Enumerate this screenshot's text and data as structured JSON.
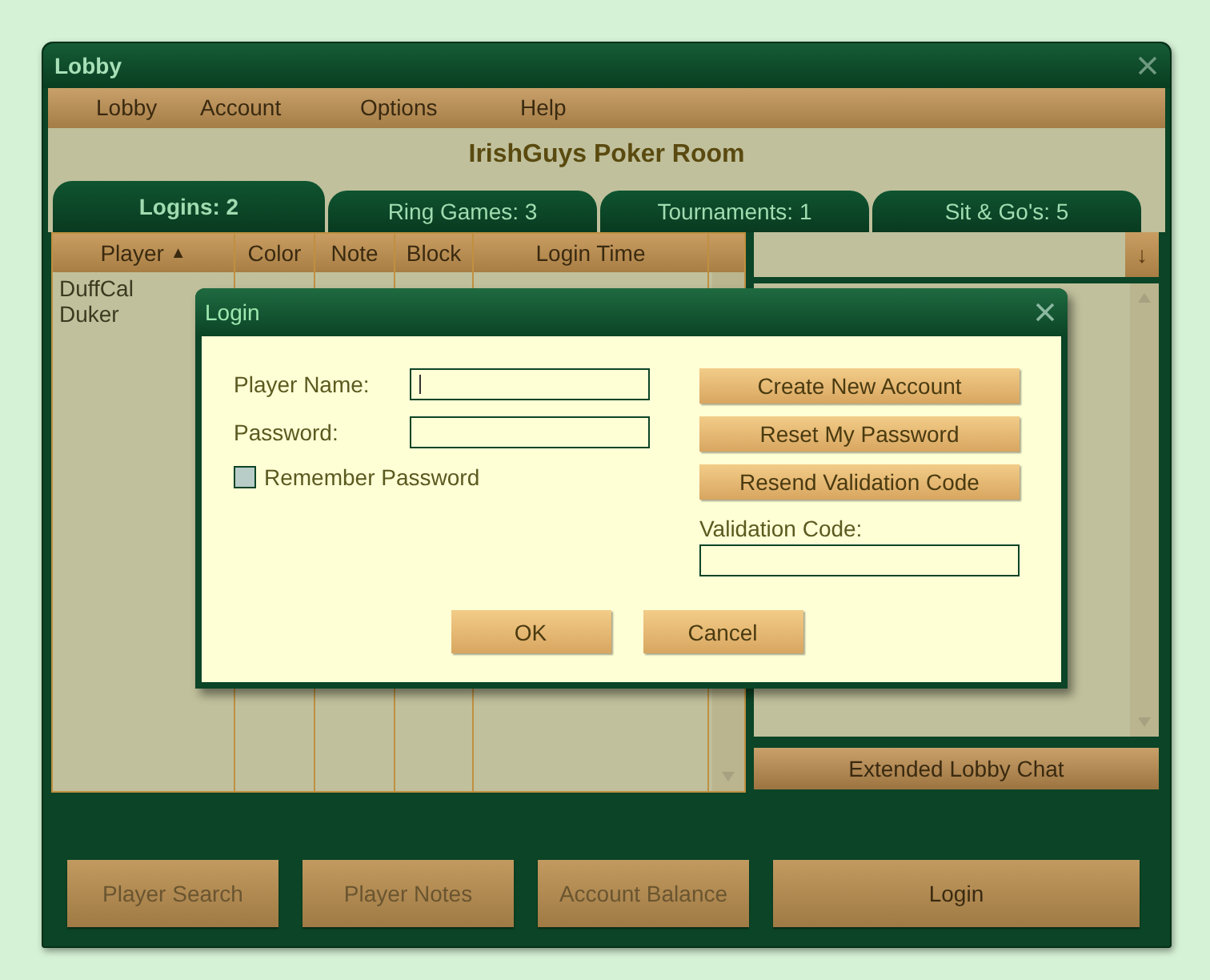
{
  "window": {
    "title": "Lobby"
  },
  "menu": [
    "Lobby",
    "Account",
    "Options",
    "Help"
  ],
  "room_title": "IrishGuys Poker Room",
  "tabs": [
    {
      "label": "Logins: 2",
      "selected": true
    },
    {
      "label": "Ring Games: 3",
      "selected": false
    },
    {
      "label": "Tournaments: 1",
      "selected": false
    },
    {
      "label": "Sit & Go's: 5",
      "selected": false
    }
  ],
  "table": {
    "columns": [
      {
        "label": "Player",
        "sort_mark": "▲"
      },
      {
        "label": "Color"
      },
      {
        "label": "Note"
      },
      {
        "label": "Block"
      },
      {
        "label": "Login Time"
      }
    ],
    "rows": [
      {
        "player": "DuffCal"
      },
      {
        "player": "Duker"
      }
    ]
  },
  "chat_panel": {
    "dropdown_button": "↓",
    "extended_chat_button": "Extended Lobby Chat"
  },
  "bottom_buttons": [
    {
      "label": "Player Search",
      "disabled": true
    },
    {
      "label": "Player Notes",
      "disabled": true
    },
    {
      "label": "Account Balance",
      "disabled": true
    },
    {
      "label": "Login",
      "disabled": false
    }
  ],
  "dialog": {
    "title": "Login",
    "fields": [
      {
        "label": "Player Name:",
        "focused": true
      },
      {
        "label": "Password:",
        "focused": false
      }
    ],
    "remember": {
      "label": "Remember Password",
      "checked": false
    },
    "side_buttons": [
      "Create New Account",
      "Reset My Password",
      "Resend Validation Code"
    ],
    "validation": {
      "label": "Validation Code:"
    },
    "buttons": [
      "OK",
      "Cancel"
    ]
  }
}
